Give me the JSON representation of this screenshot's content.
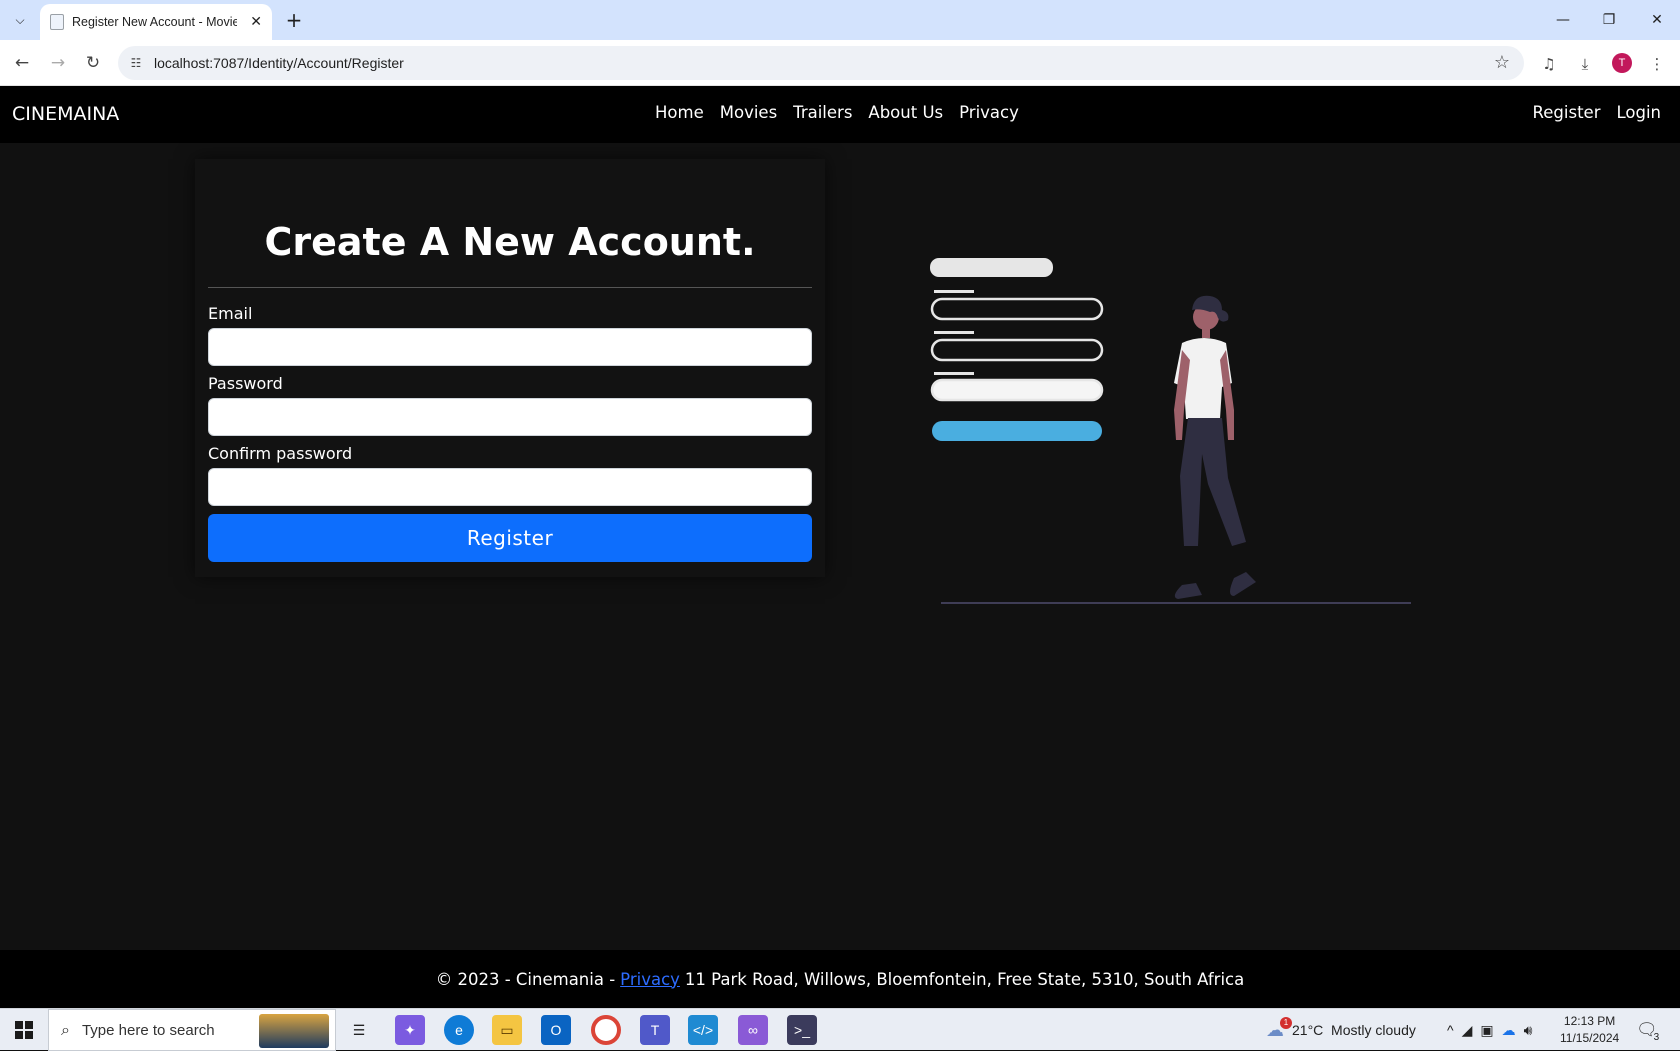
{
  "browser": {
    "tab_title": "Register New Account - MovieS",
    "url": "localhost:7087/Identity/Account/Register",
    "profile_initial": "T"
  },
  "site": {
    "brand": "CINEMAINA",
    "nav": [
      "Home",
      "Movies",
      "Trailers",
      "About Us",
      "Privacy"
    ],
    "register_link": "Register",
    "login_link": "Login"
  },
  "form": {
    "title": "Create A New Account.",
    "email_label": "Email",
    "password_label": "Password",
    "confirm_label": "Confirm password",
    "email_value": "",
    "password_value": "",
    "confirm_value": "",
    "submit_label": "Register"
  },
  "footer": {
    "prefix": "© 2023 - Cinemania -",
    "privacy_link": "Privacy",
    "address": "11 Park Road, Willows, Bloemfontein, Free State, 5310, South Africa"
  },
  "taskbar": {
    "search_placeholder": "Type here to search",
    "weather": "21°C  Mostly cloudy",
    "weather_badge": "1",
    "time": "12:13 PM",
    "date": "11/15/2024",
    "notifications": "3"
  },
  "colors": {
    "accent": "#0d6efd",
    "page_bg": "#111111",
    "nav_bg": "#000000",
    "illustration_button": "#4aaee0"
  }
}
